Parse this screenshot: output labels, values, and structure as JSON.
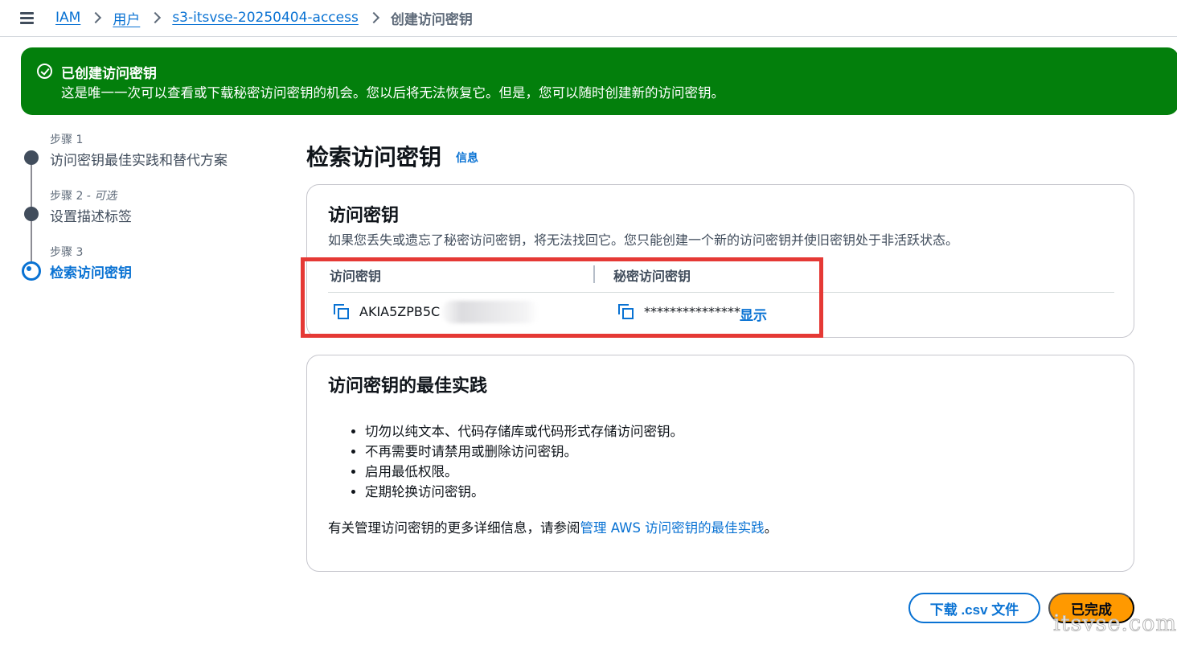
{
  "breadcrumb": {
    "items": [
      "IAM",
      "用户",
      "s3-itsvse-20250404-access"
    ],
    "current": "创建访问密钥"
  },
  "flash": {
    "title": "已创建访问密钥",
    "message": "这是唯一一次可以查看或下载秘密访问密钥的机会。您以后将无法恢复它。但是，您可以随时创建新的访问密钥。",
    "color": "#037f0c"
  },
  "steps": [
    {
      "number": "步骤 1",
      "optional": "",
      "label": "访问密钥最佳实践和替代方案"
    },
    {
      "number": "步骤 2",
      "optional": " - 可选",
      "label": "设置描述标签"
    },
    {
      "number": "步骤 3",
      "optional": "",
      "label": "检索访问密钥"
    }
  ],
  "page": {
    "title": "检索访问密钥",
    "info_link": "信息"
  },
  "access_key_card": {
    "title": "访问密钥",
    "description": "如果您丢失或遗忘了秘密访问密钥，将无法找回它。您只能创建一个新的访问密钥并使旧密钥处于非活跃状态。",
    "col_access_key": "访问密钥",
    "col_secret_key": "秘密访问密钥",
    "access_key_value": "AKIA5ZPB5C",
    "secret_key_masked": "***************",
    "show_label": "显示"
  },
  "best_practices_card": {
    "title": "访问密钥的最佳实践",
    "items": [
      "切勿以纯文本、代码存储库或代码形式存储访问密钥。",
      "不再需要时请禁用或删除访问密钥。",
      "启用最低权限。",
      "定期轮换访问密钥。"
    ],
    "more_prefix": "有关管理访问密钥的更多详细信息，请参阅",
    "more_link": "管理 AWS 访问密钥的最佳实践",
    "more_suffix": "。"
  },
  "actions": {
    "download_label": "下载 .csv 文件",
    "done_label": "已完成"
  },
  "watermark": "itsvse.com",
  "colors": {
    "link": "#0972d3",
    "primary_button": "#ff9900",
    "highlight_box": "#e53935"
  }
}
